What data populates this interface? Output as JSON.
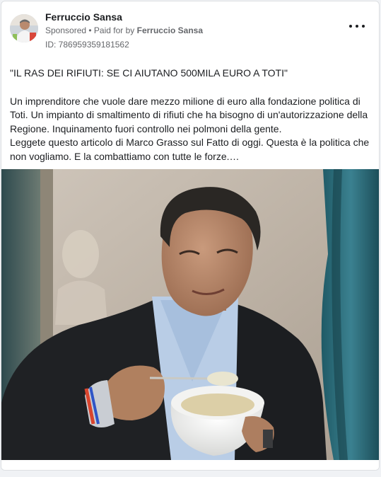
{
  "post": {
    "page_name": "Ferruccio Sansa",
    "sponsored_label": "Sponsored",
    "separator": " • ",
    "paid_for_prefix": "Paid for by ",
    "paid_for_name": "Ferruccio Sansa",
    "ad_id": "ID: 786959359181562",
    "headline": "\"IL RAS DEI RIFIUTI: SE CI AIUTANO 500MILA EURO A TOTI\"",
    "paragraph_1": "Un imprenditore che vuole dare mezzo milione di euro alla fondazione politica di Toti. Un impianto di smaltimento di rifiuti che ha bisogno di un'autorizzazione della Regione. Inquinamento fuori controllo nei polmoni della gente.",
    "paragraph_2": "Leggete questo articolo di Marco Grasso sul Fatto di oggi. Questa è la politica che non vogliamo. E la combattiamo con tutte le forze.…"
  },
  "icons": {
    "more": "more-options-icon",
    "avatar": "profile-avatar"
  },
  "colors": {
    "page_bg": "#f0f2f5",
    "card_bg": "#ffffff",
    "primary_text": "#1c1e21",
    "secondary_text": "#65676b"
  }
}
